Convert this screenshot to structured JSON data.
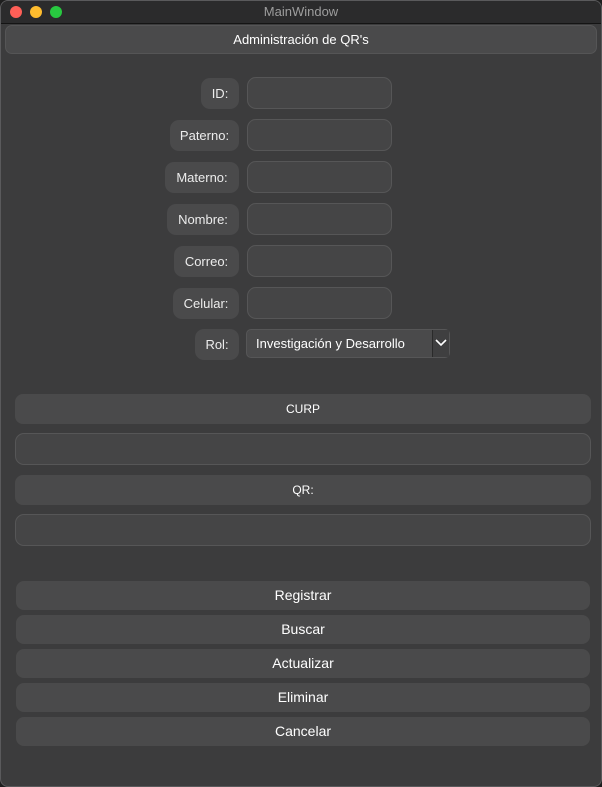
{
  "window": {
    "title": "MainWindow"
  },
  "header": {
    "title": "Administración de QR's"
  },
  "form": {
    "fields": [
      {
        "label": "ID:",
        "value": ""
      },
      {
        "label": "Paterno:",
        "value": ""
      },
      {
        "label": "Materno:",
        "value": ""
      },
      {
        "label": "Nombre:",
        "value": ""
      },
      {
        "label": "Correo:",
        "value": ""
      },
      {
        "label": "Celular:",
        "value": ""
      }
    ],
    "rol": {
      "label": "Rol:",
      "selected": "Investigación y Desarrollo"
    }
  },
  "curp": {
    "label": "CURP",
    "value": ""
  },
  "qr": {
    "label": "QR:",
    "value": ""
  },
  "buttons": {
    "registrar": "Registrar",
    "buscar": "Buscar",
    "actualizar": "Actualizar",
    "eliminar": "Eliminar",
    "cancelar": "Cancelar"
  }
}
